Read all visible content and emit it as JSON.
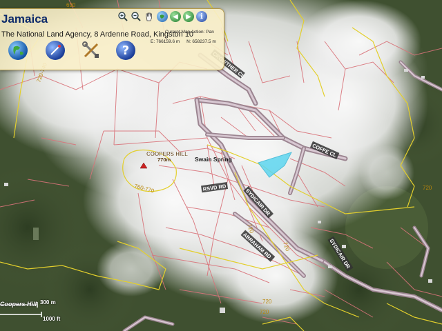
{
  "app": {
    "title": "Jamaica",
    "agency": "The National Land Agency, 8 Ardenne Road, Kingston 10",
    "current_action_label": "Current Map Action: Pan",
    "easting": "E: 766159.6 m",
    "northing": "N: 658237.5 m"
  },
  "toolbar": {
    "icons": [
      "zoom-in-icon",
      "zoom-out-icon",
      "pan-hand-icon",
      "full-extent-icon",
      "back-arrow-icon",
      "forward-arrow-icon",
      "info-icon"
    ]
  },
  "tools": {
    "icons": [
      "globe-icon",
      "measure-compass-icon",
      "tools-icon",
      "help-icon"
    ]
  },
  "map_labels": {
    "crowther": "CROWTHER CL",
    "coffe": "COFFE CL",
    "coopers_hill": "COOPERS HILL",
    "elev_770": "770m",
    "swain_spring": "Swain Spring",
    "rsvd_rd": "RSVD RD",
    "sydicair_dr": "SYDICAIR DR",
    "abraham_rd": "ABRAHAM RD",
    "sydicair_dr2": "SYDICAIR DR",
    "contour_760_770": "760-770",
    "contour_720": "720",
    "contour_720b": "720",
    "contour_720c": "720",
    "contour_720d": "720",
    "contour_720e": "720",
    "contour_690": "690",
    "contour_720_740": "720-740"
  },
  "scale": {
    "m": "300 m",
    "ft": "1000 ft",
    "place": "Coopers Hill"
  },
  "colors": {
    "parcel": "#d9737a",
    "contour": "#e3cf2c",
    "road": "#b08a9e",
    "highlight": "#5ed6f0"
  }
}
